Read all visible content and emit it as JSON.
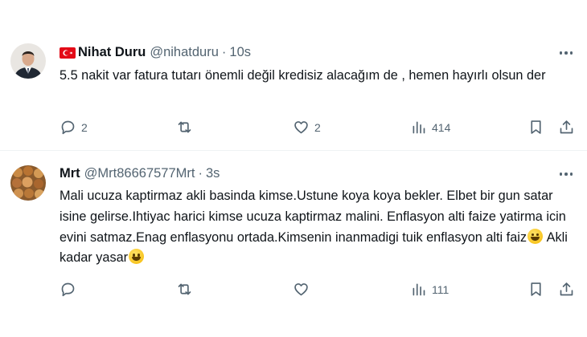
{
  "tweets": [
    {
      "name": "Nihat Duru",
      "handle": "@nihatduru",
      "separator": "·",
      "time": "10s",
      "text": "5.5 nakit var fatura tutarı önemli değil kredisiz alacağım de , hemen hayırlı olsun der",
      "replies": "2",
      "retweets": "",
      "likes": "2",
      "views": "414",
      "flag_icon": "turkey-flag-icon"
    },
    {
      "name": "Mrt",
      "handle": "@Mrt86667577Mrt",
      "separator": "·",
      "time": "3s",
      "text_parts": [
        "Mali ucuza kaptirmaz akli basinda kimse.Ustune koya koya bekler. Elbet bir gun satar isine gelirse.Ihtiyac harici kimse ucuza kaptirmaz malini. Enflasyon alti faize yatirma icin evini satmaz.Enag enflasyonu ortada.Kimsenin inanmadigi tuik enflasyon alti faiz",
        " Akli kadar yasar"
      ],
      "replies": "",
      "retweets": "",
      "likes": "",
      "views": "111",
      "emoji_icon": "grinning-face-emoji-icon"
    }
  ],
  "colors": {
    "text": "#0f1419",
    "secondary": "#536471",
    "divider": "#eff3f4",
    "flag_red": "#e30a17"
  }
}
